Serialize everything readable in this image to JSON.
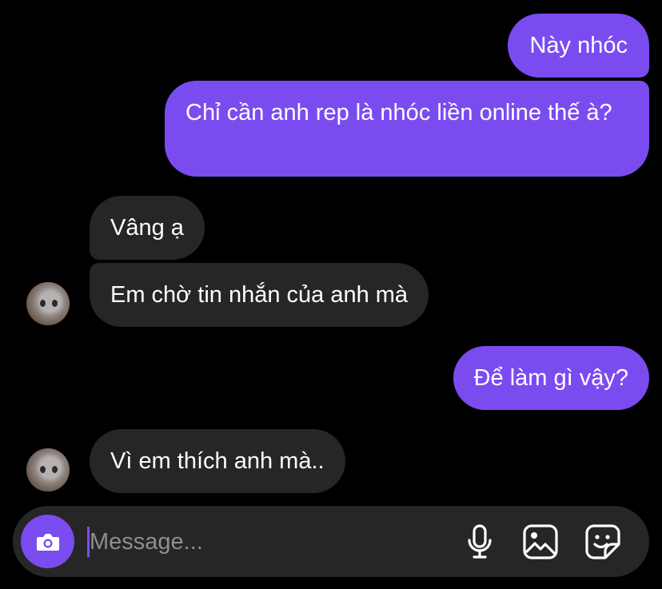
{
  "messages": [
    {
      "id": "b1",
      "direction": "sent",
      "text": "Này nhóc"
    },
    {
      "id": "b2",
      "direction": "sent",
      "text": "Chỉ cần anh rep là nhóc liền online thế à?"
    },
    {
      "id": "b3",
      "direction": "received",
      "text": "Vâng ạ"
    },
    {
      "id": "b4",
      "direction": "received",
      "text": "Em chờ tin nhắn của anh mà"
    },
    {
      "id": "b5",
      "direction": "sent",
      "text": "Để làm gì vậy?"
    },
    {
      "id": "b6",
      "direction": "received",
      "text": "Vì em thích anh mà.."
    }
  ],
  "composer": {
    "placeholder": "Message...",
    "value": "",
    "icons": [
      "camera-icon",
      "microphone-icon",
      "gallery-icon",
      "sticker-icon"
    ]
  },
  "colors": {
    "background": "#000000",
    "sent_bubble": "#7a4cf0",
    "received_bubble": "#262626",
    "composer": "#262626",
    "accent": "#7a4cf0",
    "placeholder": "#8e8e8e"
  }
}
